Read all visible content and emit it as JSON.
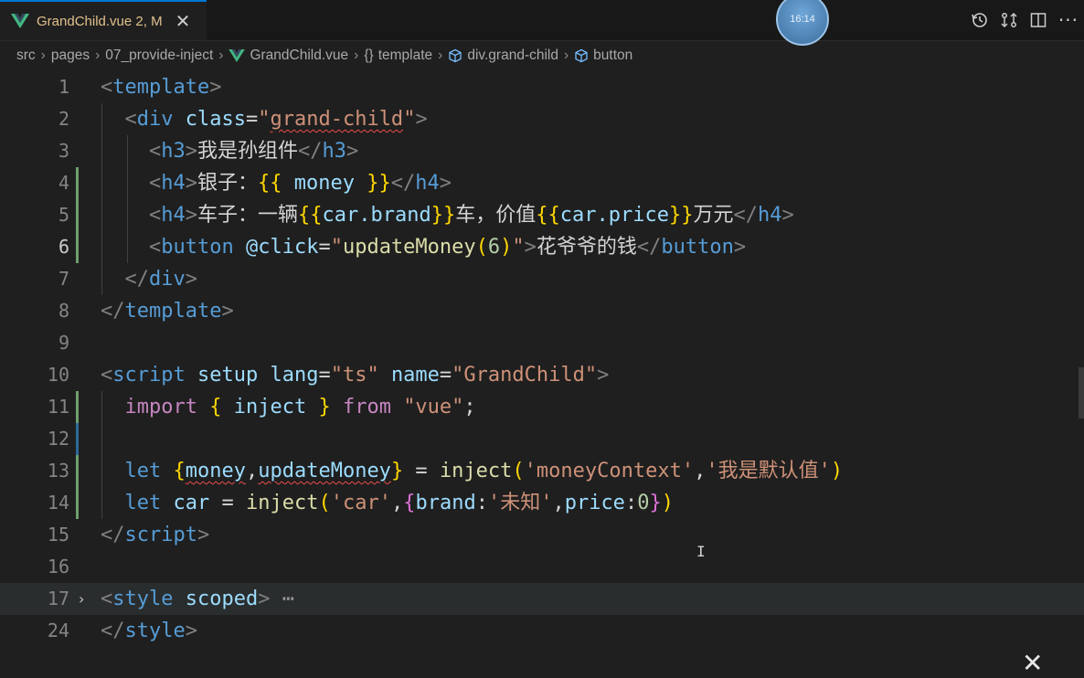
{
  "tab": {
    "title": "GrandChild.vue",
    "status": "2, M",
    "close_glyph": "✕"
  },
  "avatar": {
    "text": "16:14"
  },
  "toolbar": {
    "more_glyph": "···"
  },
  "breadcrumb": [
    "src",
    "pages",
    "07_provide-inject",
    "GrandChild.vue",
    "template",
    "div.grand-child",
    "button"
  ],
  "breadcrumb_icons": {
    "file": "vue-icon",
    "template": "braces-icon",
    "div": "cube-icon",
    "button": "cube-icon"
  },
  "colors": {
    "accent": "#0078d4",
    "modified": "#e2c08d",
    "git_added": "#2ea043"
  },
  "editor": {
    "lines": [
      {
        "num": "1",
        "tokens": [
          [
            "t-br",
            "<"
          ],
          [
            "t-tag",
            "template"
          ],
          [
            "t-br",
            ">"
          ]
        ]
      },
      {
        "num": "2",
        "tokens": [
          [
            "t-text",
            "  "
          ],
          [
            "t-br",
            "<"
          ],
          [
            "t-tag",
            "div"
          ],
          [
            "t-text",
            " "
          ],
          [
            "t-attr",
            "class"
          ],
          [
            "t-text",
            "="
          ],
          [
            "t-str",
            "\""
          ],
          [
            "t-str sq",
            "grand-child"
          ],
          [
            "t-str",
            "\""
          ],
          [
            "t-br",
            ">"
          ]
        ]
      },
      {
        "num": "3",
        "tokens": [
          [
            "t-text",
            "    "
          ],
          [
            "t-br",
            "<"
          ],
          [
            "t-tag",
            "h3"
          ],
          [
            "t-br",
            ">"
          ],
          [
            "t-text",
            "我是孙组件"
          ],
          [
            "t-br",
            "</"
          ],
          [
            "t-tag",
            "h3"
          ],
          [
            "t-br",
            ">"
          ]
        ]
      },
      {
        "num": "4",
        "tokens": [
          [
            "t-text",
            "    "
          ],
          [
            "t-br",
            "<"
          ],
          [
            "t-tag",
            "h4"
          ],
          [
            "t-br",
            ">"
          ],
          [
            "t-text",
            "银子："
          ],
          [
            "t-mus",
            "{{"
          ],
          [
            "t-var",
            " money "
          ],
          [
            "t-mus",
            "}}"
          ],
          [
            "t-br",
            "</"
          ],
          [
            "t-tag",
            "h4"
          ],
          [
            "t-br",
            ">"
          ]
        ]
      },
      {
        "num": "5",
        "tokens": [
          [
            "t-text",
            "    "
          ],
          [
            "t-br",
            "<"
          ],
          [
            "t-tag",
            "h4"
          ],
          [
            "t-br",
            ">"
          ],
          [
            "t-text",
            "车子：一辆"
          ],
          [
            "t-mus",
            "{{"
          ],
          [
            "t-var",
            "car.brand"
          ],
          [
            "t-mus",
            "}}"
          ],
          [
            "t-text",
            "车，价值"
          ],
          [
            "t-mus",
            "{{"
          ],
          [
            "t-var",
            "car.price"
          ],
          [
            "t-mus",
            "}}"
          ],
          [
            "t-text",
            "万元"
          ],
          [
            "t-br",
            "</"
          ],
          [
            "t-tag",
            "h4"
          ],
          [
            "t-br",
            ">"
          ]
        ]
      },
      {
        "num": "6",
        "tokens": [
          [
            "t-text",
            "    "
          ],
          [
            "t-br",
            "<"
          ],
          [
            "t-tag",
            "button"
          ],
          [
            "t-text",
            " "
          ],
          [
            "t-attr",
            "@click"
          ],
          [
            "t-text",
            "="
          ],
          [
            "t-str",
            "\""
          ],
          [
            "t-fn",
            "updateMoney"
          ],
          [
            "t-mus",
            "("
          ],
          [
            "t-num",
            "6"
          ],
          [
            "t-mus",
            ")"
          ],
          [
            "t-str",
            "\""
          ],
          [
            "t-br",
            ">"
          ],
          [
            "t-text",
            "花爷爷的钱"
          ],
          [
            "t-br",
            "</"
          ],
          [
            "t-tag",
            "button"
          ],
          [
            "t-br",
            ">"
          ]
        ]
      },
      {
        "num": "7",
        "tokens": [
          [
            "t-text",
            "  "
          ],
          [
            "t-br",
            "</"
          ],
          [
            "t-tag",
            "div"
          ],
          [
            "t-br",
            ">"
          ]
        ]
      },
      {
        "num": "8",
        "tokens": [
          [
            "t-br",
            "</"
          ],
          [
            "t-tag",
            "template"
          ],
          [
            "t-br",
            ">"
          ]
        ]
      },
      {
        "num": "9",
        "tokens": []
      },
      {
        "num": "10",
        "tokens": [
          [
            "t-br",
            "<"
          ],
          [
            "t-tag",
            "script"
          ],
          [
            "t-text",
            " "
          ],
          [
            "t-attr",
            "setup"
          ],
          [
            "t-text",
            " "
          ],
          [
            "t-attr",
            "lang"
          ],
          [
            "t-text",
            "="
          ],
          [
            "t-str",
            "\"ts\""
          ],
          [
            "t-text",
            " "
          ],
          [
            "t-attr",
            "name"
          ],
          [
            "t-text",
            "="
          ],
          [
            "t-str",
            "\"GrandChild\""
          ],
          [
            "t-br",
            ">"
          ]
        ]
      },
      {
        "num": "11",
        "tokens": [
          [
            "t-text",
            "  "
          ],
          [
            "t-kw",
            "import"
          ],
          [
            "t-text",
            " "
          ],
          [
            "t-mus",
            "{"
          ],
          [
            "t-var",
            " inject "
          ],
          [
            "t-mus",
            "}"
          ],
          [
            "t-text",
            " "
          ],
          [
            "t-kw",
            "from"
          ],
          [
            "t-text",
            " "
          ],
          [
            "t-str",
            "\"vue\""
          ],
          [
            "t-text",
            ";"
          ]
        ]
      },
      {
        "num": "12",
        "tokens": []
      },
      {
        "num": "13",
        "tokens": [
          [
            "t-text",
            "  "
          ],
          [
            "t-kw2",
            "let"
          ],
          [
            "t-text",
            " "
          ],
          [
            "t-mus",
            "{"
          ],
          [
            "t-var sq",
            "money"
          ],
          [
            "t-text",
            ","
          ],
          [
            "t-var sq",
            "updateMoney"
          ],
          [
            "t-mus",
            "}"
          ],
          [
            "t-text",
            " = "
          ],
          [
            "t-fn",
            "inject"
          ],
          [
            "t-mus",
            "("
          ],
          [
            "t-str",
            "'moneyContext'"
          ],
          [
            "t-text",
            ","
          ],
          [
            "t-str",
            "'我是默认值'"
          ],
          [
            "t-mus",
            ")"
          ]
        ]
      },
      {
        "num": "14",
        "tokens": [
          [
            "t-text",
            "  "
          ],
          [
            "t-kw2",
            "let"
          ],
          [
            "t-text",
            " "
          ],
          [
            "t-var",
            "car"
          ],
          [
            "t-text",
            " = "
          ],
          [
            "t-fn",
            "inject"
          ],
          [
            "t-mus",
            "("
          ],
          [
            "t-str",
            "'car'"
          ],
          [
            "t-text",
            ","
          ],
          [
            "t-brc",
            "{"
          ],
          [
            "t-var",
            "brand"
          ],
          [
            "t-text",
            ":"
          ],
          [
            "t-str",
            "'未知'"
          ],
          [
            "t-text",
            ","
          ],
          [
            "t-var",
            "price"
          ],
          [
            "t-text",
            ":"
          ],
          [
            "t-num",
            "0"
          ],
          [
            "t-brc",
            "}"
          ],
          [
            "t-mus",
            ")"
          ]
        ]
      },
      {
        "num": "15",
        "tokens": [
          [
            "t-br",
            "</"
          ],
          [
            "t-tag",
            "script"
          ],
          [
            "t-br",
            ">"
          ]
        ]
      },
      {
        "num": "16",
        "tokens": []
      },
      {
        "num": "17",
        "tokens": [
          [
            "t-br",
            "<"
          ],
          [
            "t-tag",
            "style"
          ],
          [
            "t-text",
            " "
          ],
          [
            "t-attr",
            "scoped"
          ],
          [
            "t-br",
            ">"
          ],
          [
            "t-dots",
            " ⋯"
          ]
        ]
      },
      {
        "num": "24",
        "tokens": [
          [
            "t-br",
            "</"
          ],
          [
            "t-tag",
            "style"
          ],
          [
            "t-br",
            ">"
          ]
        ]
      }
    ],
    "active_line": "6",
    "fold_chevron": "›",
    "cursor_glyph": "I"
  },
  "corner": {
    "close_glyph": "✕"
  }
}
